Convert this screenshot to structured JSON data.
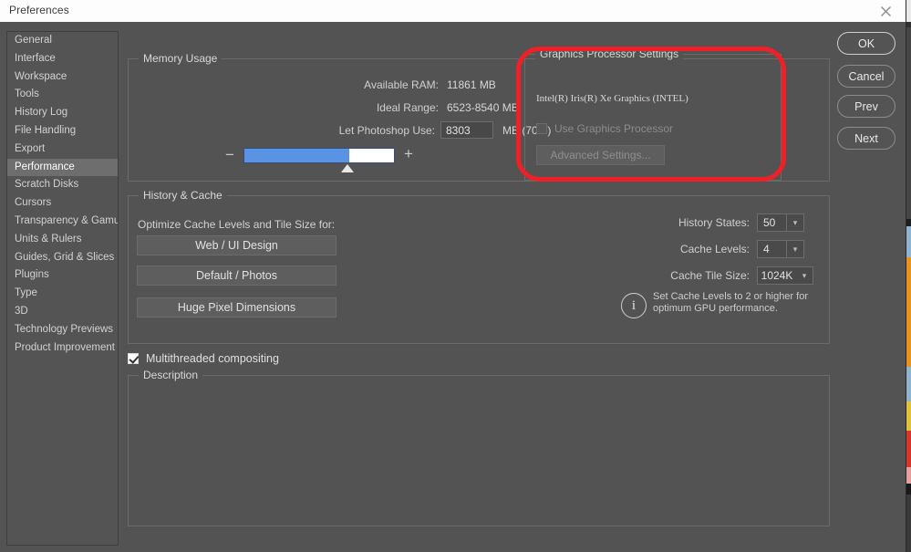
{
  "window": {
    "title": "Preferences",
    "close_icon": "close-icon"
  },
  "sidebar": {
    "items": [
      {
        "label": "General",
        "selected": false
      },
      {
        "label": "Interface",
        "selected": false
      },
      {
        "label": "Workspace",
        "selected": false
      },
      {
        "label": "Tools",
        "selected": false
      },
      {
        "label": "History Log",
        "selected": false
      },
      {
        "label": "File Handling",
        "selected": false
      },
      {
        "label": "Export",
        "selected": false
      },
      {
        "label": "Performance",
        "selected": true
      },
      {
        "label": "Scratch Disks",
        "selected": false
      },
      {
        "label": "Cursors",
        "selected": false
      },
      {
        "label": "Transparency & Gamut",
        "selected": false
      },
      {
        "label": "Units & Rulers",
        "selected": false
      },
      {
        "label": "Guides, Grid & Slices",
        "selected": false
      },
      {
        "label": "Plugins",
        "selected": false
      },
      {
        "label": "Type",
        "selected": false
      },
      {
        "label": "3D",
        "selected": false
      },
      {
        "label": "Technology Previews",
        "selected": false
      },
      {
        "label": "Product Improvement",
        "selected": false
      }
    ]
  },
  "memory_usage": {
    "legend": "Memory Usage",
    "available_ram_label": "Available RAM:",
    "available_ram_value": "11861 MB",
    "ideal_range_label": "Ideal Range:",
    "ideal_range_value": "6523-8540 MB",
    "let_photoshop_use_label": "Let Photoshop Use:",
    "let_photoshop_use_value": "8303",
    "unit_percent": "MB (70%)",
    "slider": {
      "minus": "−",
      "plus": "+",
      "percent": 70,
      "fill_color": "#5a93e3",
      "track_color": "#ffffff"
    }
  },
  "graphics_processor": {
    "legend": "Graphics Processor Settings",
    "detected_gpu": "Intel(R) Iris(R) Xe Graphics (INTEL)",
    "use_gpu_label": "Use Graphics Processor",
    "use_gpu_checked": false,
    "use_gpu_disabled": true,
    "advanced_settings_label": "Advanced Settings...",
    "advanced_settings_disabled": true,
    "annotation": {
      "shape": "rounded-rectangle",
      "color": "#ee2129"
    }
  },
  "history_cache": {
    "legend": "History & Cache",
    "optimize_label": "Optimize Cache Levels and Tile Size for:",
    "preset_buttons": [
      {
        "label": "Web / UI Design"
      },
      {
        "label": "Default / Photos"
      },
      {
        "label": "Huge Pixel Dimensions"
      }
    ],
    "history_states_label": "History States:",
    "history_states_value": "50",
    "cache_levels_label": "Cache Levels:",
    "cache_levels_value": "4",
    "cache_tile_size_label": "Cache Tile Size:",
    "cache_tile_size_value": "1024K",
    "info_icon": "info-icon",
    "info_text": "Set Cache Levels to 2 or higher for optimum GPU performance.",
    "dropdown_arrow": "chevron-down-icon"
  },
  "multithreaded": {
    "label": "Multithreaded compositing",
    "checked": true
  },
  "description": {
    "legend": "Description",
    "text": ""
  },
  "buttons": {
    "ok": "OK",
    "cancel": "Cancel",
    "prev": "Prev",
    "next": "Next"
  }
}
